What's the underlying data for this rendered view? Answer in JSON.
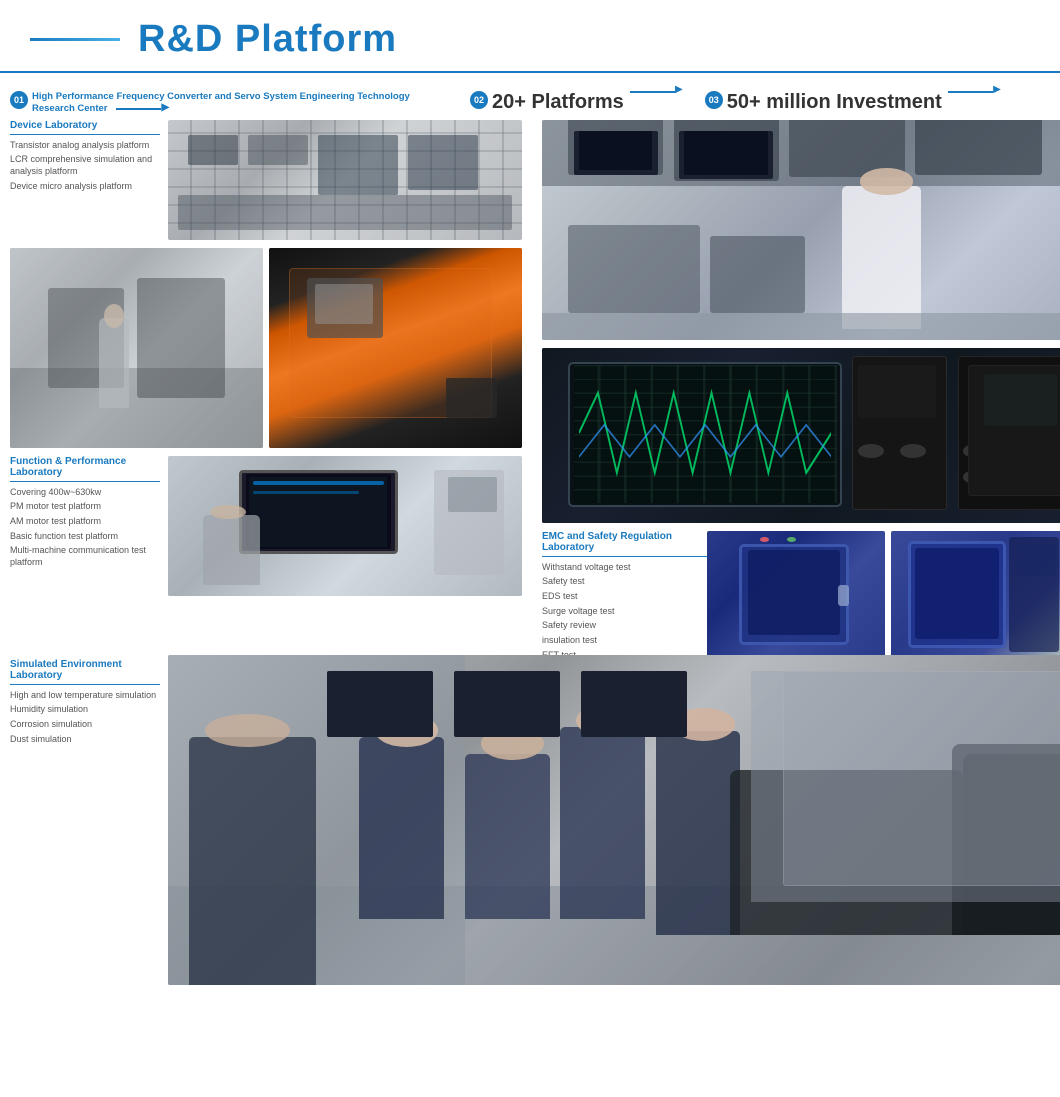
{
  "header": {
    "title": "R&D Platform",
    "line_color": "#1a7abf"
  },
  "sections": {
    "s01": {
      "number": "01",
      "title": "High Performance Frequency Converter and Servo System Engineering Technology Research Center"
    },
    "s02": {
      "number": "02",
      "title": "20+ Platforms"
    },
    "s03": {
      "number": "03",
      "title": "50+ million Investment"
    }
  },
  "device_lab": {
    "title": "Device Laboratory",
    "items": [
      "Transistor analog analysis platform",
      "LCR comprehensive simulation and analysis platform",
      "Device micro analysis platform"
    ]
  },
  "func_perf": {
    "title": "Function & Performance Laboratory",
    "items": [
      "Covering 400w~630kw",
      "PM motor test platform",
      "AM motor test platform",
      "Basic function test platform",
      "Multi-machine communication test platform"
    ]
  },
  "emc_lab": {
    "title": "EMC and Safety Regulation Laboratory",
    "items": [
      "Withstand voltage test",
      "Safety test",
      "EDS test",
      "Surge voltage test",
      "Safety review",
      "insulation test",
      "EFT test"
    ]
  },
  "sim_env": {
    "title": "Simulated Environment Laboratory",
    "items": [
      "High and low temperature simulation",
      "Humidity simulation",
      "Corrosion simulation",
      "Dust simulation"
    ]
  }
}
